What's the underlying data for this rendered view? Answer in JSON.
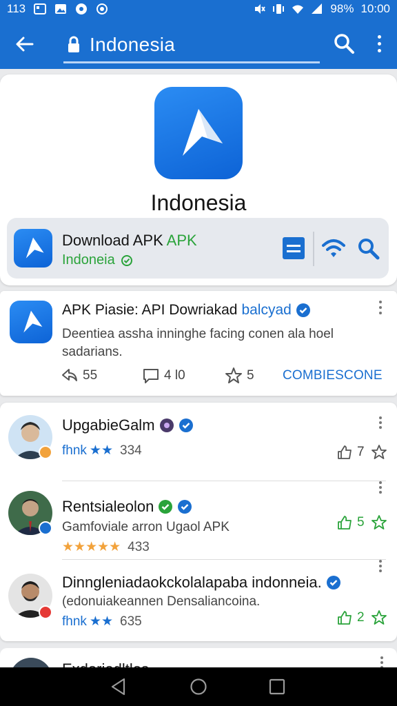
{
  "status_bar": {
    "left_text": "113",
    "battery": "98%",
    "time": "10:00"
  },
  "app_bar": {
    "url_text": "Indonesia",
    "icons": [
      "back-arrow-icon",
      "lock-icon",
      "search-icon",
      "more-vert-icon"
    ]
  },
  "hero": {
    "title": "Indonesia",
    "download_title": "Download APK",
    "download_title_accent": "APK",
    "download_subtitle": "Indoneia"
  },
  "post": {
    "title": "APK Piasie: API Dowriakad",
    "title_accent": "balcyad",
    "description": "Deentiea assha inninghe facing conen ala hoel sadarians.",
    "comments": "55",
    "replies": "4 l0",
    "stars": "5",
    "action_link": "COMBIESCONE"
  },
  "users": [
    {
      "name": "UpgabieGalm",
      "meta_prefix": "fhnk",
      "meta_count": "334",
      "likes": "7",
      "avatar_color": "#d9b99a",
      "badge_color": "#f2a23b",
      "like_color": "#555555"
    },
    {
      "name": "Rentsialeolon",
      "subtitle": "Gamfoviale arron Ugaol APK",
      "meta_count": "433",
      "likes": "5",
      "avatar_color": "#c4a386",
      "badge_color": "#1a6fd0",
      "like_color": "#2aa33a"
    },
    {
      "name": "Dinngleniadaokckolalapaba indonneia.",
      "subtitle": "(edonuiakeannen Densaliancoina.",
      "meta_prefix": "fhnk",
      "meta_count": "635",
      "likes": "2",
      "avatar_color": "#b88b6a",
      "badge_color": "#e53935",
      "like_color": "#2aa33a"
    }
  ],
  "partial": {
    "name": "Exdoriodltlos"
  },
  "colors": {
    "primary": "#1a6fd0",
    "accent_green": "#2aa33a",
    "star_orange": "#f2a23b"
  }
}
